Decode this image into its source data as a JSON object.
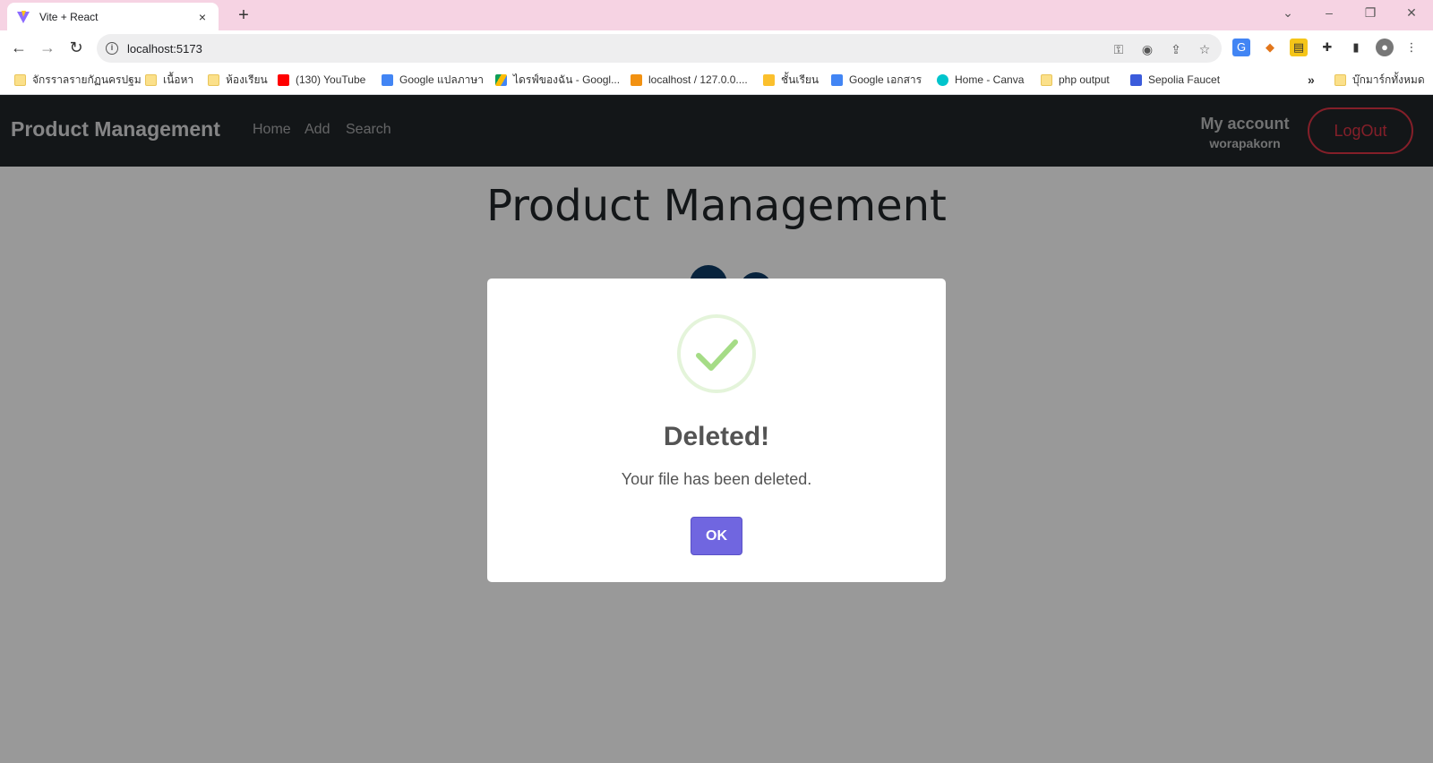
{
  "browser": {
    "tab_title": "Vite + React",
    "url": "localhost:5173",
    "new_tab": "+",
    "close": "×"
  },
  "bookmarks": [
    "จักรราลรายกัฏนครปฐม",
    "เนื้อหา",
    "ห้องเรียน",
    "(130) YouTube",
    "Google แปลภาษา",
    "ไดรฟ์ของฉัน - Googl...",
    "localhost / 127.0.0....",
    "ชั้นเรียน",
    "Google เอกสาร",
    "Home - Canva",
    "php output",
    "Sepolia Faucet",
    "บุ๊กมาร์กทั้งหมด"
  ],
  "navbar": {
    "brand": "Product Management",
    "links": [
      "Home",
      "Add",
      "Search"
    ],
    "account_title": "My account",
    "account_user": "worapakorn",
    "logout_label": "LogOut"
  },
  "page": {
    "title": "Product Management"
  },
  "modal": {
    "title": "Deleted!",
    "text": "Your file has been deleted.",
    "ok_label": "OK"
  },
  "colors": {
    "navbar_bg": "#212529",
    "logout": "#dc3545",
    "ok_button": "#7066e0",
    "success": "#a5dc86",
    "tabstrip": "#f6d3e3"
  }
}
